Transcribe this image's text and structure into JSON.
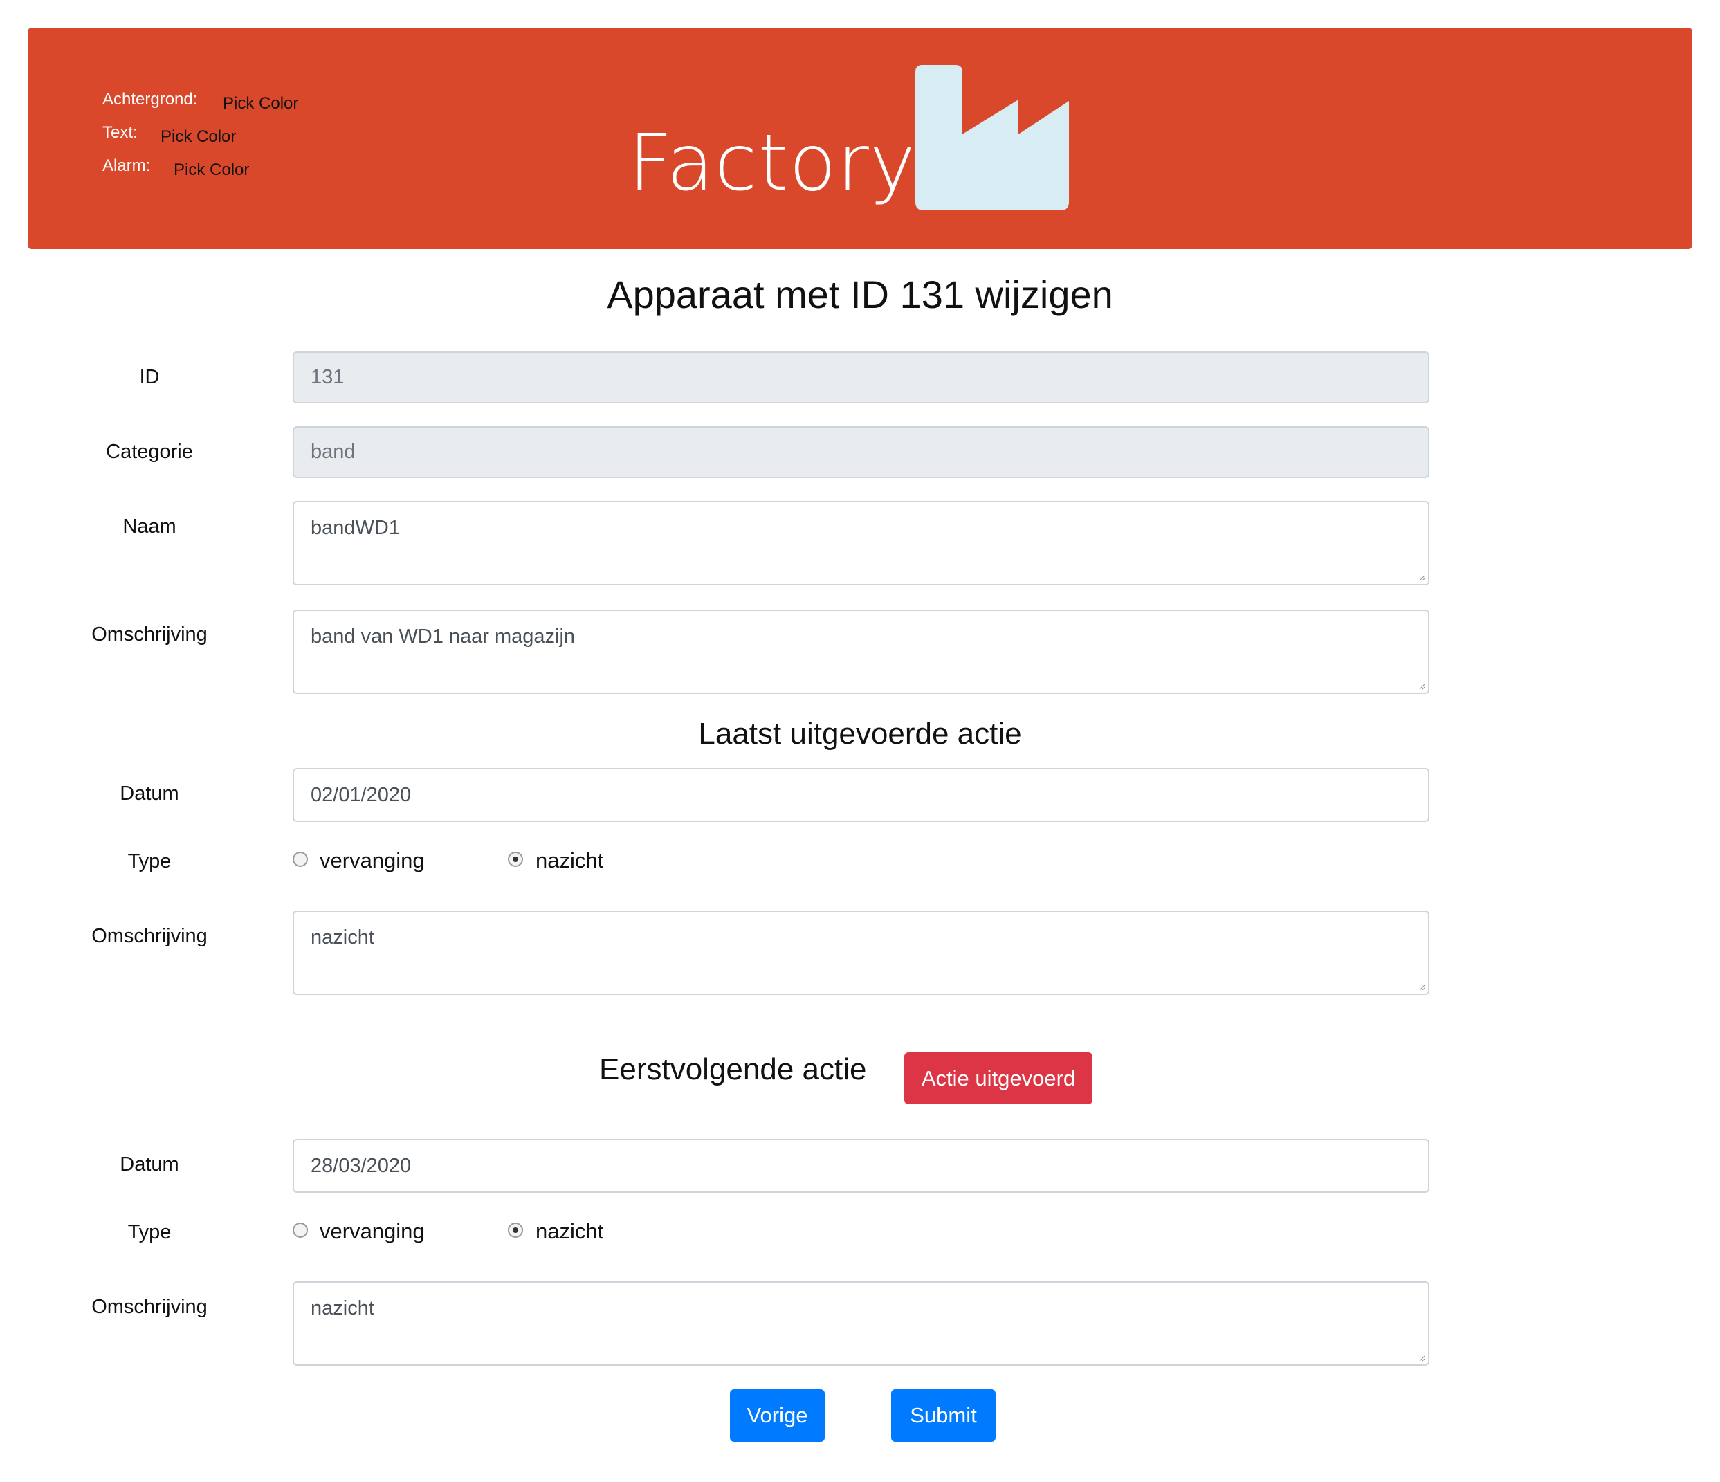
{
  "header": {
    "brand": "Factory",
    "background_color": "#d9482b",
    "icon": "factory-icon",
    "color_settings": [
      {
        "label": "Achtergrond:",
        "action": "Pick Color"
      },
      {
        "label": "Text:",
        "action": "Pick Color"
      },
      {
        "label": "Alarm:",
        "action": "Pick Color"
      }
    ]
  },
  "page_title": "Apparaat met ID 131 wijzigen",
  "device": {
    "id_label": "ID",
    "id_value": "131",
    "category_label": "Categorie",
    "category_value": "band",
    "name_label": "Naam",
    "name_value": "bandWD1",
    "description_label": "Omschrijving",
    "description_value": "band van WD1 naar magazijn"
  },
  "last_action": {
    "heading": "Laatst uitgevoerde actie",
    "date_label": "Datum",
    "date_value": "02/01/2020",
    "type_label": "Type",
    "options": [
      "vervanging",
      "nazicht"
    ],
    "selected": "nazicht",
    "description_label": "Omschrijving",
    "description_value": "nazicht"
  },
  "next_action": {
    "heading": "Eerstvolgende actie",
    "done_button": "Actie uitgevoerd",
    "date_label": "Datum",
    "date_value": "28/03/2020",
    "type_label": "Type",
    "options": [
      "vervanging",
      "nazicht"
    ],
    "selected": "nazicht",
    "description_label": "Omschrijving",
    "description_value": "nazicht"
  },
  "buttons": {
    "previous": "Vorige",
    "submit": "Submit"
  },
  "colors": {
    "danger": "#dc3545",
    "primary": "#007bff",
    "icon_fill": "#d8ecf3"
  }
}
